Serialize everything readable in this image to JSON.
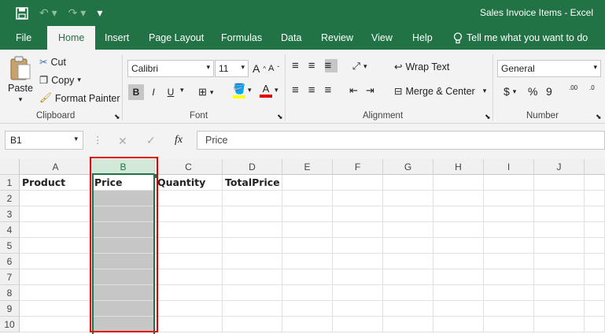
{
  "window": {
    "title": "Sales Invoice Items  -  Excel"
  },
  "qat": {
    "save_icon": "save-icon",
    "undo_icon": "undo-icon",
    "redo_icon": "redo-icon",
    "customize": "▾"
  },
  "tabs": [
    "File",
    "Home",
    "Insert",
    "Page Layout",
    "Formulas",
    "Data",
    "Review",
    "View",
    "Help"
  ],
  "tell_me": "Tell me what you want to do",
  "clipboard": {
    "paste": "Paste",
    "cut": "Cut",
    "copy": "Copy",
    "format_painter": "Format Painter",
    "label": "Clipboard"
  },
  "font": {
    "name": "Calibri",
    "size": "11",
    "bold": "B",
    "italic": "I",
    "underline": "U",
    "grow": "A",
    "shrink": "A",
    "label": "Font",
    "highlight_color": "#ffff00",
    "font_color": "#e00000"
  },
  "alignment": {
    "wrap": "Wrap Text",
    "merge": "Merge & Center",
    "label": "Alignment"
  },
  "number": {
    "format": "General",
    "currency": "$",
    "percent": "%",
    "comma": "9",
    "inc_decimal": ".00",
    "dec_decimal": ".0",
    "label": "Number"
  },
  "formula_bar": {
    "namebox": "B1",
    "fx": "fx",
    "value": "Price"
  },
  "sheet": {
    "columns": [
      "A",
      "B",
      "C",
      "D",
      "E",
      "F",
      "G",
      "H",
      "I",
      "J"
    ],
    "rows": [
      "1",
      "2",
      "3",
      "4",
      "5",
      "6",
      "7",
      "8",
      "9",
      "10"
    ],
    "headers": {
      "A1": "Product",
      "B1": "Price",
      "C1": "Quantity",
      "D1": "TotalPrice"
    },
    "selected_column": "B",
    "accent": "#217346",
    "highlight_border": "#e00000"
  }
}
